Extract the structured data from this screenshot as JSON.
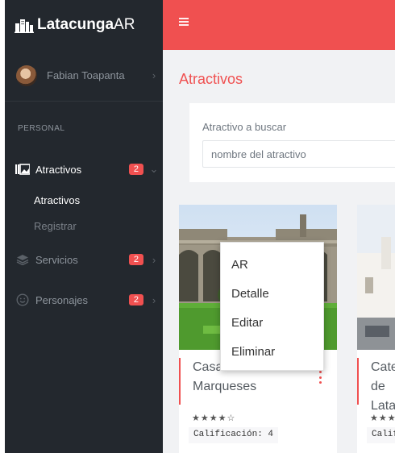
{
  "brand": {
    "name_bold": "Latacunga",
    "name_suffix": "AR",
    "icon": "city-buildings-icon"
  },
  "user": {
    "name": "Fabian Toapanta",
    "avatar": "user-avatar"
  },
  "sidebar": {
    "section_title": "PERSONAL",
    "items": [
      {
        "label": "Atractivos",
        "badge": "2",
        "icon": "gallery-icon",
        "active": true,
        "chevron": "chevron-down-icon"
      },
      {
        "label": "Servicios",
        "badge": "2",
        "icon": "layers-icon",
        "active": false,
        "chevron": "chevron-right-icon"
      },
      {
        "label": "Personajes",
        "badge": "2",
        "icon": "smile-icon",
        "active": false,
        "chevron": "chevron-right-icon"
      }
    ],
    "subitems": [
      {
        "label": "Atractivos",
        "active": true
      },
      {
        "label": "Registrar",
        "active": false
      }
    ]
  },
  "topbar": {
    "menu_icon": "hamburger-icon"
  },
  "page": {
    "title": "Atractivos"
  },
  "search": {
    "label": "Atractivo a buscar",
    "placeholder": "nombre del atractivo",
    "value": ""
  },
  "cards": [
    {
      "title": "Casa de los Marqueses",
      "stars": "★★★★☆",
      "rating_text": "Calificación: 4"
    },
    {
      "title": "Catedral de Latacunga",
      "stars": "★★★",
      "rating_text": "Calificación"
    }
  ],
  "context_menu": {
    "items": [
      "AR",
      "Detalle",
      "Editar",
      "Eliminar"
    ]
  },
  "colors": {
    "accent": "#f05050",
    "sidebar_bg": "#23282e",
    "content_bg": "#f1f2f4"
  }
}
